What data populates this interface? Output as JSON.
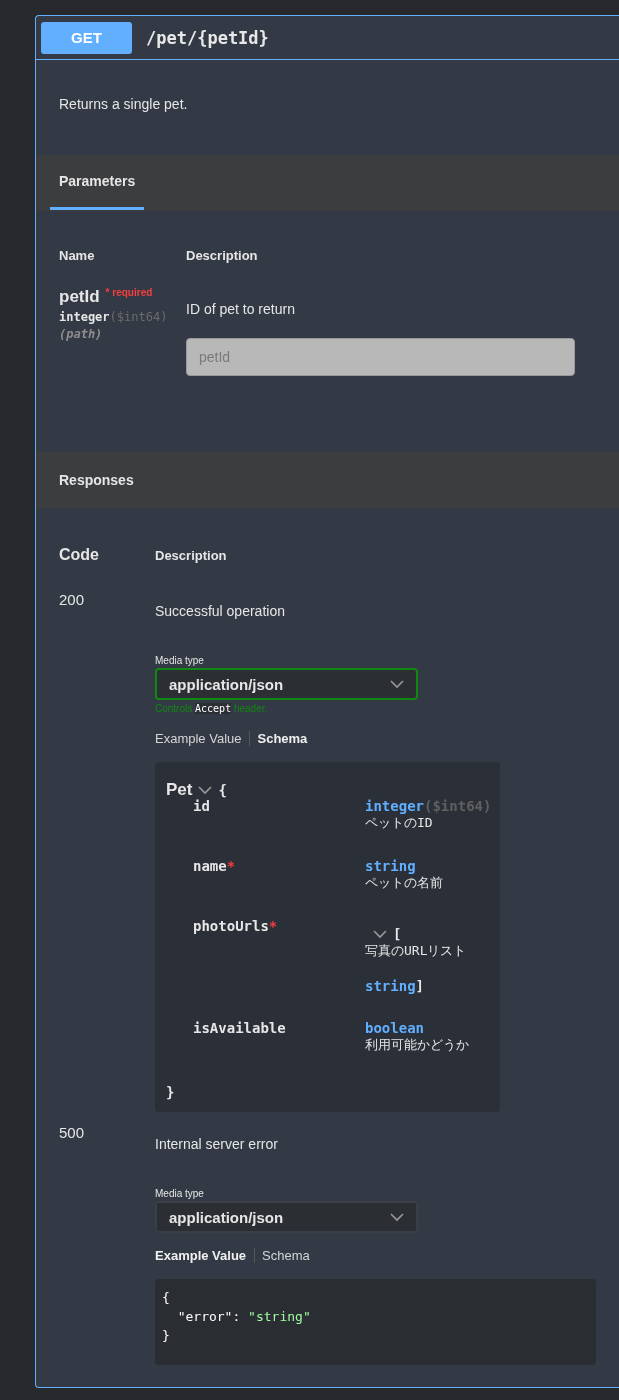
{
  "operation": {
    "method": "GET",
    "path": "/pet/{petId}",
    "summary": "Returns a single pet."
  },
  "parameters": {
    "tab": {
      "label": "Parameters",
      "selected": true
    },
    "columns": [
      "Name",
      "Description"
    ],
    "items": [
      {
        "name": "petId",
        "required": true,
        "required_mark": "*",
        "required_label": "required",
        "type": "integer",
        "format": "($int64)",
        "location": "(path)",
        "description": "ID of pet to return",
        "placeholder": "petId"
      }
    ]
  },
  "responses": {
    "title": "Responses",
    "columns": [
      "Code",
      "Description"
    ],
    "items": [
      {
        "code": "200",
        "description": "Successful operation",
        "media_label": "Media type",
        "media_value": "application/json",
        "validated": true,
        "note": {
          "before": "Controls",
          "code": "Accept",
          "after": "header."
        },
        "tabs": [
          {
            "label": "Example Value",
            "selected": false
          },
          {
            "label": "Schema",
            "selected": true
          }
        ],
        "body": {
          "kind": "schema",
          "model": "Pet",
          "open": "{",
          "close": "}",
          "required_mark": "*",
          "fields": [
            {
              "kind": "scalar",
              "name": "id",
              "required": false,
              "type": "integer",
              "format": "($int64)",
              "description": "ペットのID"
            },
            {
              "kind": "scalar",
              "name": "name",
              "required": true,
              "type": "string",
              "description": "ペットの名前"
            },
            {
              "kind": "array",
              "name": "photoUrls",
              "required": true,
              "open": "[",
              "description": "写真のURLリスト",
              "type": "string",
              "close": "]"
            },
            {
              "kind": "scalar",
              "name": "isAvailable",
              "required": false,
              "type": "boolean",
              "description": "利用可能かどうか"
            }
          ]
        }
      },
      {
        "code": "500",
        "description": "Internal server error",
        "media_label": "Media type",
        "media_value": "application/json",
        "validated": false,
        "tabs": [
          {
            "label": "Example Value",
            "selected": true
          },
          {
            "label": "Schema",
            "selected": false
          }
        ],
        "body": {
          "kind": "example",
          "lines": [
            [
              {
                "kind": "punct",
                "text": "{"
              }
            ],
            [
              {
                "kind": "key",
                "text": "  \"error\""
              },
              {
                "kind": "punct",
                "text": ": "
              },
              {
                "kind": "string",
                "text": "\"string\""
              }
            ],
            [
              {
                "kind": "punct",
                "text": "}"
              }
            ]
          ]
        }
      }
    ]
  }
}
